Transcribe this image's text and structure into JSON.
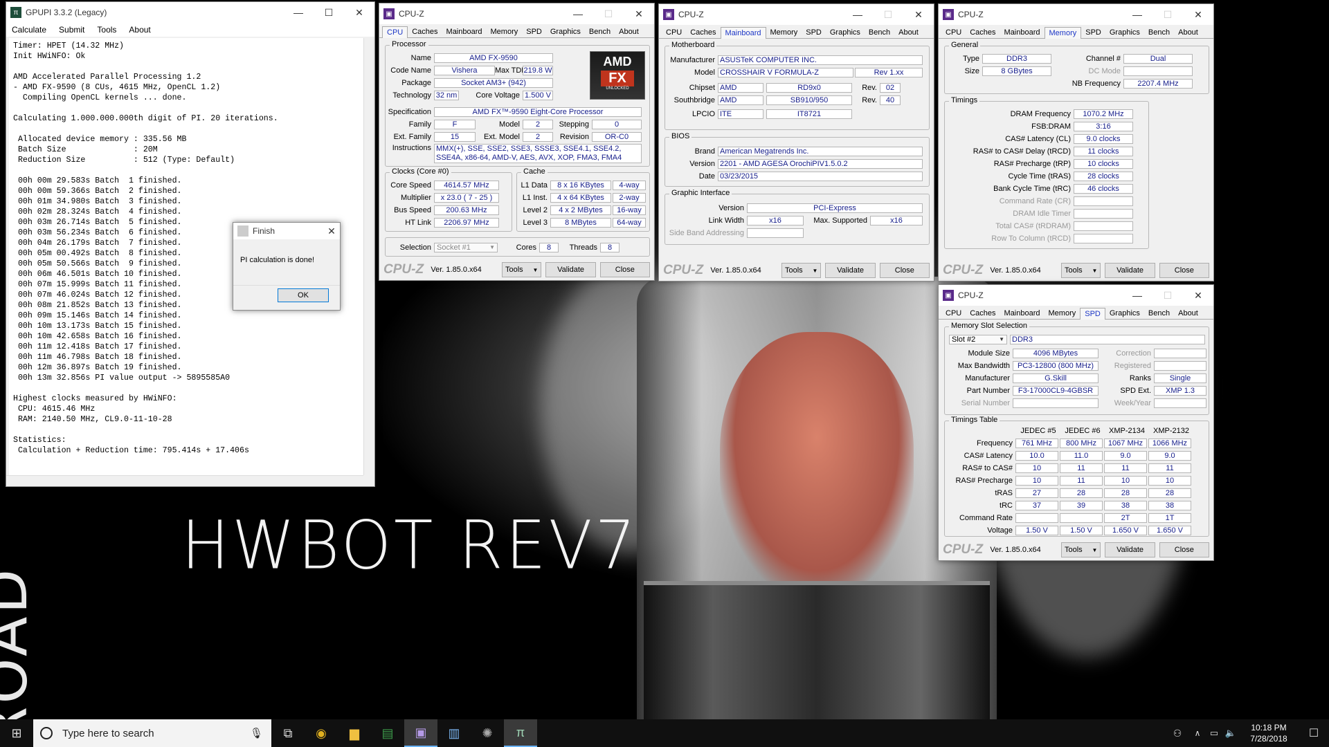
{
  "wallpaper": {
    "hwbot": "HWBOT REV7",
    "road": "ROAD"
  },
  "gpupi": {
    "title": "GPUPI 3.3.2 (Legacy)",
    "menu": [
      "Calculate",
      "Submit",
      "Tools",
      "About"
    ],
    "console": "Timer: HPET (14.32 MHz)\nInit HWiNFO: Ok\n\nAMD Accelerated Parallel Processing 1.2\n- AMD FX-9590 (8 CUs, 4615 MHz, OpenCL 1.2)\n  Compiling OpenCL kernels ... done.\n\nCalculating 1.000.000.000th digit of PI. 20 iterations.\n\n Allocated device memory : 335.56 MB\n Batch Size              : 20M\n Reduction Size          : 512 (Type: Default)\n\n 00h 00m 29.583s Batch  1 finished.\n 00h 00m 59.366s Batch  2 finished.\n 00h 01m 34.980s Batch  3 finished.\n 00h 02m 28.324s Batch  4 finished.\n 00h 03m 26.714s Batch  5 finished.\n 00h 03m 56.234s Batch  6 finished.\n 00h 04m 26.179s Batch  7 finished.\n 00h 05m 00.492s Batch  8 finished.\n 00h 05m 50.566s Batch  9 finished.\n 00h 06m 46.501s Batch 10 finished.\n 00h 07m 15.999s Batch 11 finished.\n 00h 07m 46.024s Batch 12 finished.\n 00h 08m 21.852s Batch 13 finished.\n 00h 09m 15.146s Batch 14 finished.\n 00h 10m 13.173s Batch 15 finished.\n 00h 10m 42.658s Batch 16 finished.\n 00h 11m 12.418s Batch 17 finished.\n 00h 11m 46.798s Batch 18 finished.\n 00h 12m 36.897s Batch 19 finished.\n 00h 13m 32.856s PI value output -> 5895585A0\n\nHighest clocks measured by HWiNFO:\n CPU: 4615.46 MHz\n RAM: 2140.50 MHz, CL9.0-11-10-28\n\nStatistics:\n Calculation + Reduction time: 795.414s + 17.406s"
  },
  "finish": {
    "title": "Finish",
    "message": "PI calculation is done!",
    "ok": "OK"
  },
  "cpuz_common": {
    "title": "CPU-Z",
    "tabs": [
      "CPU",
      "Caches",
      "Mainboard",
      "Memory",
      "SPD",
      "Graphics",
      "Bench",
      "About"
    ],
    "logo": "CPU-Z",
    "version": "Ver. 1.85.0.x64",
    "tools": "Tools",
    "validate": "Validate",
    "close": "Close"
  },
  "cpu": {
    "processor_legend": "Processor",
    "name_l": "Name",
    "name": "AMD FX-9590",
    "code_l": "Code Name",
    "code": "Vishera",
    "tdp_l": "Max TDP",
    "tdp": "219.8 W",
    "package_l": "Package",
    "package": "Socket AM3+ (942)",
    "tech_l": "Technology",
    "tech": "32 nm",
    "volt_l": "Core Voltage",
    "volt": "1.500 V",
    "spec_l": "Specification",
    "spec": "AMD FX™-9590 Eight-Core Processor",
    "family_l": "Family",
    "family": "F",
    "model_l": "Model",
    "model": "2",
    "stepping_l": "Stepping",
    "stepping": "0",
    "extfam_l": "Ext. Family",
    "extfam": "15",
    "extmodel_l": "Ext. Model",
    "extmodel": "2",
    "rev_l": "Revision",
    "rev": "OR-C0",
    "instr_l": "Instructions",
    "instr": "MMX(+), SSE, SSE2, SSE3, SSSE3, SSE4.1, SSE4.2, SSE4A, x86-64, AMD-V, AES, AVX, XOP, FMA3, FMA4",
    "clocks_legend": "Clocks (Core #0)",
    "cs_l": "Core Speed",
    "cs": "4614.57 MHz",
    "mult_l": "Multiplier",
    "mult": "x 23.0 ( 7 - 25 )",
    "bus_l": "Bus Speed",
    "bus": "200.63 MHz",
    "ht_l": "HT Link",
    "ht": "2206.97 MHz",
    "cache_legend": "Cache",
    "l1d_l": "L1 Data",
    "l1d": "8 x 16 KBytes",
    "l1d_w": "4-way",
    "l1i_l": "L1 Inst.",
    "l1i": "4 x 64 KBytes",
    "l1i_w": "2-way",
    "l2_l": "Level 2",
    "l2": "4 x 2 MBytes",
    "l2_w": "16-way",
    "l3_l": "Level 3",
    "l3": "8 MBytes",
    "l3_w": "64-way",
    "sel_l": "Selection",
    "sel": "Socket #1",
    "cores_l": "Cores",
    "cores": "8",
    "threads_l": "Threads",
    "threads": "8",
    "amd_logo": "AMD",
    "fx_logo": "FX",
    "unlocked": "UNLOCKED"
  },
  "mb": {
    "mb_legend": "Motherboard",
    "manu_l": "Manufacturer",
    "manu": "ASUSTeK COMPUTER INC.",
    "model_l": "Model",
    "model": "CROSSHAIR V FORMULA-Z",
    "model_rev": "Rev 1.xx",
    "chipset_l": "Chipset",
    "chipset_v": "AMD",
    "chipset": "RD9x0",
    "chipset_rev_l": "Rev.",
    "chipset_rev": "02",
    "sb_l": "Southbridge",
    "sb_v": "AMD",
    "sb": "SB910/950",
    "sb_rev_l": "Rev.",
    "sb_rev": "40",
    "lpcio_l": "LPCIO",
    "lpcio_v": "ITE",
    "lpcio": "IT8721",
    "bios_legend": "BIOS",
    "brand_l": "Brand",
    "brand": "American Megatrends Inc.",
    "ver_l": "Version",
    "ver": "2201 - AMD AGESA OrochiPIV1.5.0.2",
    "date_l": "Date",
    "date": "03/23/2015",
    "gi_legend": "Graphic Interface",
    "giver_l": "Version",
    "giver": "PCI-Express",
    "lw_l": "Link Width",
    "lw": "x16",
    "ms_l": "Max. Supported",
    "ms": "x16",
    "sba_l": "Side Band Addressing"
  },
  "mem": {
    "gen_legend": "General",
    "type_l": "Type",
    "type": "DDR3",
    "ch_l": "Channel #",
    "ch": "Dual",
    "size_l": "Size",
    "size": "8 GBytes",
    "dc_l": "DC Mode",
    "nb_l": "NB Frequency",
    "nb": "2207.4 MHz",
    "tim_legend": "Timings",
    "rows": [
      {
        "l": "DRAM Frequency",
        "v": "1070.2 MHz",
        "dim": false
      },
      {
        "l": "FSB:DRAM",
        "v": "3:16",
        "dim": false
      },
      {
        "l": "CAS# Latency (CL)",
        "v": "9.0 clocks",
        "dim": false
      },
      {
        "l": "RAS# to CAS# Delay (tRCD)",
        "v": "11 clocks",
        "dim": false
      },
      {
        "l": "RAS# Precharge (tRP)",
        "v": "10 clocks",
        "dim": false
      },
      {
        "l": "Cycle Time (tRAS)",
        "v": "28 clocks",
        "dim": false
      },
      {
        "l": "Bank Cycle Time (tRC)",
        "v": "46 clocks",
        "dim": false
      },
      {
        "l": "Command Rate (CR)",
        "v": "",
        "dim": true
      },
      {
        "l": "DRAM Idle Timer",
        "v": "",
        "dim": true
      },
      {
        "l": "Total CAS# (tRDRAM)",
        "v": "",
        "dim": true
      },
      {
        "l": "Row To Column (tRCD)",
        "v": "",
        "dim": true
      }
    ]
  },
  "spd": {
    "slot_legend": "Memory Slot Selection",
    "slot": "Slot #2",
    "slot_type": "DDR3",
    "msize_l": "Module Size",
    "msize": "4096 MBytes",
    "corr_l": "Correction",
    "mbw_l": "Max Bandwidth",
    "mbw": "PC3-12800 (800 MHz)",
    "reg_l": "Registered",
    "manu_l": "Manufacturer",
    "manu": "G.Skill",
    "ranks_l": "Ranks",
    "ranks": "Single",
    "pn_l": "Part Number",
    "pn": "F3-17000CL9-4GBSR",
    "ext_l": "SPD Ext.",
    "ext": "XMP 1.3",
    "sn_l": "Serial Number",
    "wy_l": "Week/Year",
    "tt_legend": "Timings Table",
    "cols": [
      "JEDEC #5",
      "JEDEC #6",
      "XMP-2134",
      "XMP-2132"
    ],
    "rows": [
      {
        "l": "Frequency",
        "v": [
          "761 MHz",
          "800 MHz",
          "1067 MHz",
          "1066 MHz"
        ]
      },
      {
        "l": "CAS# Latency",
        "v": [
          "10.0",
          "11.0",
          "9.0",
          "9.0"
        ]
      },
      {
        "l": "RAS# to CAS#",
        "v": [
          "10",
          "11",
          "11",
          "11"
        ]
      },
      {
        "l": "RAS# Precharge",
        "v": [
          "10",
          "11",
          "10",
          "10"
        ]
      },
      {
        "l": "tRAS",
        "v": [
          "27",
          "28",
          "28",
          "28"
        ]
      },
      {
        "l": "tRC",
        "v": [
          "37",
          "39",
          "38",
          "38"
        ]
      },
      {
        "l": "Command Rate",
        "v": [
          "",
          "",
          "2T",
          "1T"
        ]
      },
      {
        "l": "Voltage",
        "v": [
          "1.50 V",
          "1.50 V",
          "1.650 V",
          "1.650 V"
        ]
      }
    ]
  },
  "taskbar": {
    "search": "Type here to search",
    "time": "10:18 PM",
    "date": "7/28/2018"
  }
}
